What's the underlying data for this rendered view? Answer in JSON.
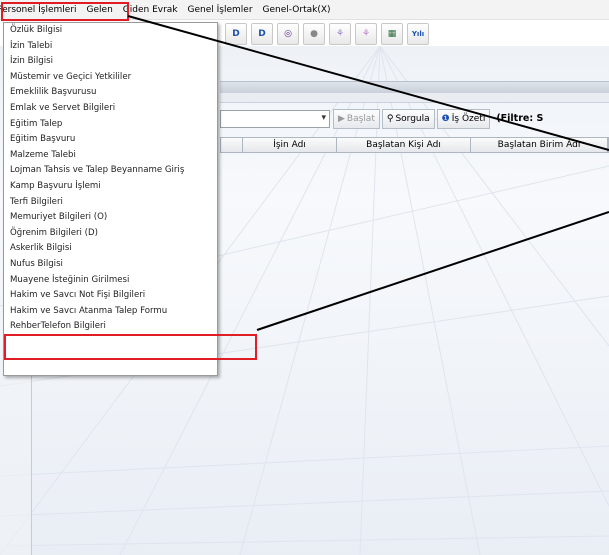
{
  "menubar": {
    "items": [
      {
        "label": "Personel İşlemleri"
      },
      {
        "label": "Gelen"
      },
      {
        "label": "Giden Evrak"
      },
      {
        "label": "Genel İşlemler"
      },
      {
        "label": "Genel-Ortak(X)"
      }
    ]
  },
  "toolbar": {
    "buttons": [
      {
        "glyph": "D",
        "icon": "document-add-icon"
      },
      {
        "glyph": "D",
        "icon": "document-delete-icon"
      },
      {
        "glyph": "◎",
        "icon": "globe-icon"
      },
      {
        "glyph": "●",
        "icon": "circle-icon"
      },
      {
        "glyph": "⚘",
        "icon": "users-icon"
      },
      {
        "glyph": "⚘",
        "icon": "users-alt-icon"
      },
      {
        "glyph": "▦",
        "icon": "grid-icon"
      },
      {
        "glyph": "Yılı",
        "icon": "year-icon"
      }
    ]
  },
  "actions": {
    "start_label": "Başlat",
    "query_label": "Sorgula",
    "summary_label": "İş Özeti",
    "filter_label": "(Filtre: S"
  },
  "grid": {
    "columns": [
      "İşin Adı",
      "Başlatan Kişi Adı",
      "Başlatan Birim Adı"
    ]
  },
  "dropdown": {
    "items": [
      "Özlük Bilgisi",
      "İzin Talebi",
      "İzin Bilgisi",
      "Müstemir ve Geçici Yetkililer",
      "Emeklilik Başvurusu",
      "Emlak ve Servet Bilgileri",
      "Eğitim Talep",
      "Eğitim Başvuru",
      "Malzeme Talebi",
      "Lojman Tahsis ve Talep Beyanname Giriş",
      "Kamp Başvuru İşlemi",
      "Terfi Bilgileri",
      "Memuriyet Bilgileri (O)",
      "Öğrenim Bilgileri (D)",
      "Askerlik Bilgisi",
      "Nufus Bilgisi",
      "Muayene İsteğinin Girilmesi",
      "Hakim ve Savcı Not Fişi Bilgileri",
      "Hakim ve Savcı Atanma Talep Formu",
      "RehberTelefon Bilgileri"
    ]
  },
  "colors": {
    "annotation": "#e01d25"
  }
}
